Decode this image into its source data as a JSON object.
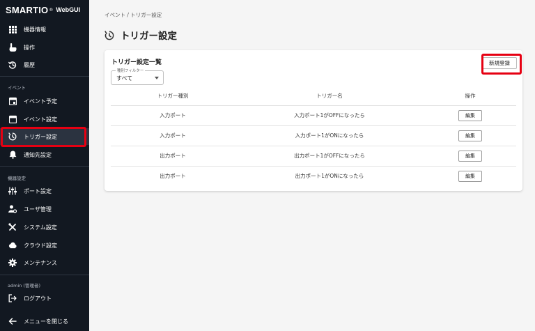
{
  "app": {
    "brand": "SMARTIO",
    "brand_reg": "®",
    "brand_sub": "WebGUI"
  },
  "sidebar": {
    "items_top": [
      {
        "label": "機器情報",
        "icon": "grid-icon"
      },
      {
        "label": "操作",
        "icon": "hand-pointer-icon"
      },
      {
        "label": "履歴",
        "icon": "history-icon"
      }
    ],
    "section_event": "イベント",
    "items_event": [
      {
        "label": "イベント予定",
        "icon": "calendar-event-icon"
      },
      {
        "label": "イベント設定",
        "icon": "calendar-icon"
      },
      {
        "label": "トリガー設定",
        "icon": "timer-trigger-icon",
        "active": true
      },
      {
        "label": "通知先設定",
        "icon": "bell-icon"
      }
    ],
    "section_device": "機器設定",
    "items_device": [
      {
        "label": "ポート設定",
        "icon": "sliders-icon"
      },
      {
        "label": "ユーザ管理",
        "icon": "user-gear-icon"
      },
      {
        "label": "システム設定",
        "icon": "tools-icon"
      },
      {
        "label": "クラウド設定",
        "icon": "cloud-icon"
      },
      {
        "label": "メンテナンス",
        "icon": "gear-icon"
      }
    ],
    "section_user": "admin (管理者)",
    "logout": "ログアウト",
    "close_menu": "メニューを閉じる"
  },
  "breadcrumb": "イベント / トリガー設定",
  "page_title": "トリガー設定",
  "card": {
    "title": "トリガー設定一覧",
    "new_button": "新規登録",
    "filter": {
      "legend": "種別フィルター",
      "value": "すべて"
    },
    "columns": [
      "トリガー種別",
      "トリガー名",
      "操作"
    ],
    "edit_label": "編集",
    "rows": [
      {
        "type": "入力ポート",
        "name": "入力ポート1がOFFになったら"
      },
      {
        "type": "入力ポート",
        "name": "入力ポート1がONになったら"
      },
      {
        "type": "出力ポート",
        "name": "出力ポート1がOFFになったら"
      },
      {
        "type": "出力ポート",
        "name": "出力ポート1がONになったら"
      }
    ]
  },
  "colors": {
    "sidebar_bg": "#121821",
    "highlight": "#e60012",
    "main_bg": "#f5f5f5"
  }
}
